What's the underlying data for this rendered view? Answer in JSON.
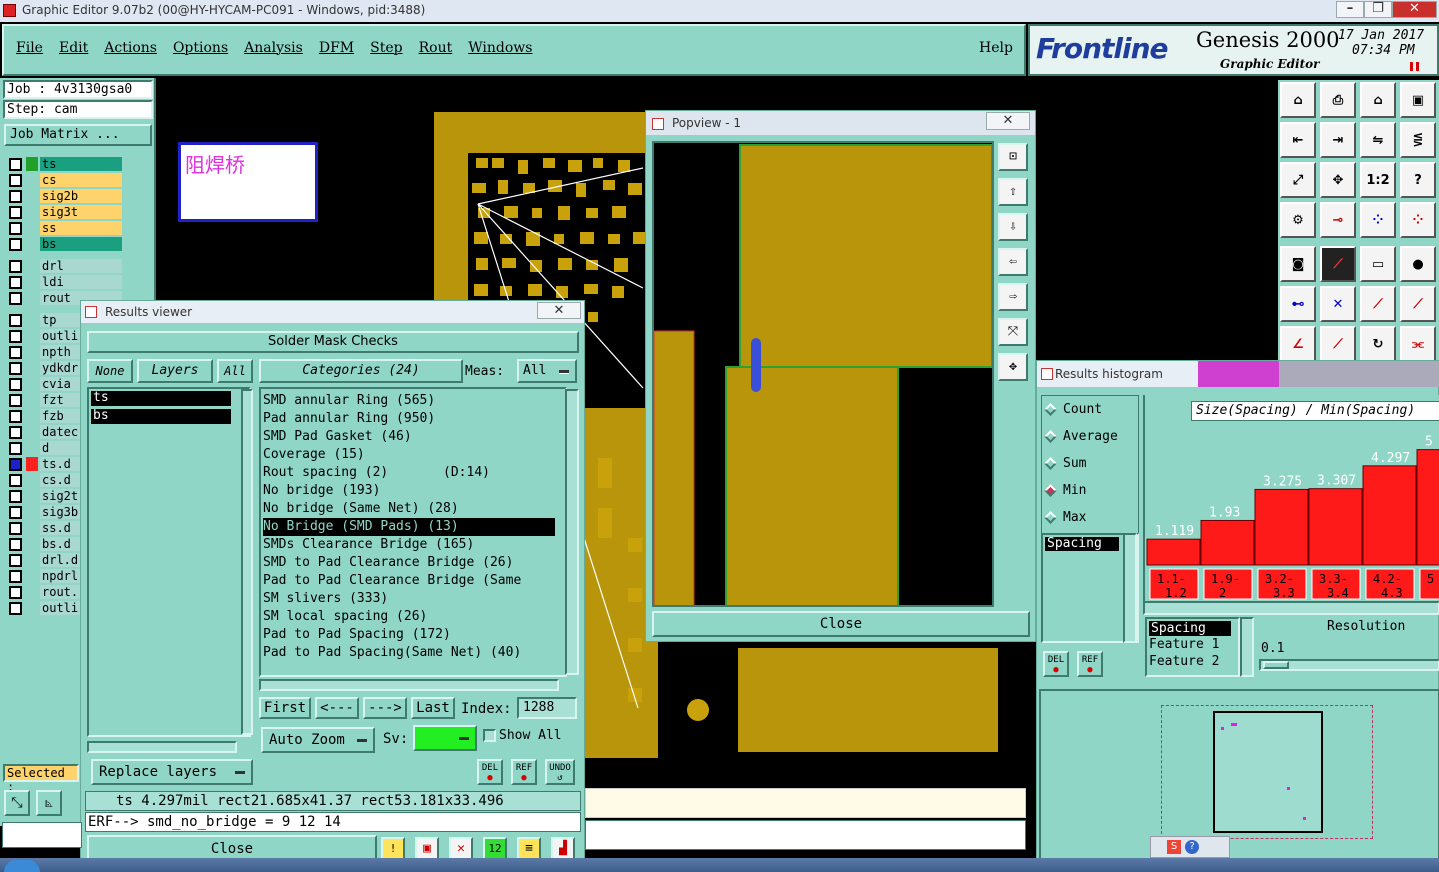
{
  "window": {
    "title": "Graphic Editor 9.07b2 (00@HY-HYCAM-PC091 - Windows, pid:3488)"
  },
  "menu": [
    "File",
    "Edit",
    "Actions",
    "Options",
    "Analysis",
    "DFM",
    "Step",
    "Rout",
    "Windows"
  ],
  "help": "Help",
  "brand": {
    "logo": "Frontline",
    "product": "Genesis 2000",
    "sub": "Graphic Editor",
    "date": "17 Jan 2017",
    "time": "07:34 PM"
  },
  "job": {
    "job": "Job : 4v3130gsa0",
    "step": "Step: cam",
    "matrix": "Job Matrix ..."
  },
  "layers": [
    {
      "name": "ts",
      "color": "#1aa080",
      "sw": "#23a02a"
    },
    {
      "name": "cs",
      "color": "#ffd36b",
      "sw": ""
    },
    {
      "name": "sig2b",
      "color": "#ffd36b",
      "sw": ""
    },
    {
      "name": "sig3t",
      "color": "#ffd36b",
      "sw": ""
    },
    {
      "name": "ss",
      "color": "#ffd36b",
      "sw": ""
    },
    {
      "name": "bs",
      "color": "#1aa080",
      "sw": ""
    },
    {
      "name": "drl",
      "color": "#a8d8d0",
      "sw": ""
    },
    {
      "name": "ldi",
      "color": "#a8d8d0",
      "sw": ""
    },
    {
      "name": "rout",
      "color": "#a8d8d0",
      "sw": ""
    },
    {
      "name": "tp",
      "color": "#a8d8d0",
      "sw": ""
    },
    {
      "name": "outli",
      "color": "#a8d8d0",
      "sw": ""
    },
    {
      "name": "npth",
      "color": "#a8d8d0",
      "sw": ""
    },
    {
      "name": "ydkdr",
      "color": "#a8d8d0",
      "sw": ""
    },
    {
      "name": "cvia",
      "color": "#a8d8d0",
      "sw": ""
    },
    {
      "name": "fzt",
      "color": "#a8d8d0",
      "sw": ""
    },
    {
      "name": "fzb",
      "color": "#a8d8d0",
      "sw": ""
    },
    {
      "name": "datec",
      "color": "#a8d8d0",
      "sw": ""
    },
    {
      "name": "d",
      "color": "#a8d8d0",
      "sw": ""
    },
    {
      "name": "ts.d",
      "color": "#a8d8d0",
      "sw": "#ff2020"
    },
    {
      "name": "cs.d",
      "color": "#a8d8d0",
      "sw": ""
    },
    {
      "name": "sig2t",
      "color": "#a8d8d0",
      "sw": ""
    },
    {
      "name": "sig3b",
      "color": "#a8d8d0",
      "sw": ""
    },
    {
      "name": "ss.d",
      "color": "#a8d8d0",
      "sw": ""
    },
    {
      "name": "bs.d",
      "color": "#a8d8d0",
      "sw": ""
    },
    {
      "name": "drl.d",
      "color": "#a8d8d0",
      "sw": ""
    },
    {
      "name": "npdrl",
      "color": "#a8d8d0",
      "sw": ""
    },
    {
      "name": "rout.",
      "color": "#a8d8d0",
      "sw": ""
    },
    {
      "name": "outli",
      "color": "#a8d8d0",
      "sw": ""
    }
  ],
  "selected": "Selected :",
  "note": "阻焊桥",
  "results": {
    "title": "Results viewer",
    "header": "Solder Mask Checks",
    "none": "None",
    "layers": "Layers",
    "all": "All",
    "categories": "Categories (24)",
    "meas": "Meas:",
    "meas_val": "All",
    "layer_list": [
      "ts",
      "bs"
    ],
    "items": [
      "SMD annular Ring (565)",
      "Pad annular Ring (950)",
      "SMD Pad Gasket (46)",
      "Coverage (15)",
      "Rout spacing (2)       (D:14)",
      "No bridge (193)",
      "No bridge (Same Net) (28)",
      "No Bridge (SMD Pads) (13)",
      "SMDs Clearance Bridge (165)",
      "SMD to Pad Clearance Bridge (26)",
      "Pad to Pad Clearance Bridge (Same",
      "SM slivers (333)",
      "SM local spacing (26)",
      "Pad to Pad Spacing (172)",
      "Pad to Pad Spacing(Same Net) (40)"
    ],
    "selected_index": 7,
    "first": "First",
    "prev": "<---",
    "next": "--->",
    "last": "Last",
    "index_label": "Index:",
    "index_val": "1288",
    "auto_zoom": "Auto Zoom",
    "sv": "Sv:",
    "show_all": "Show All",
    "replace": "Replace layers",
    "del": "DEL",
    "ref": "REF",
    "undo": "UNDO",
    "status": "ts 4.297mil   rect21.685x41.37   rect53.181x33.496",
    "erf": "ERF--> smd_no_bridge = 9 12 14",
    "close": "Close"
  },
  "popview": {
    "title": "Popview - 1",
    "close": "Close"
  },
  "histogram": {
    "title": "Results histogram",
    "options": [
      "Count",
      "Average",
      "Sum",
      "Min",
      "Max"
    ],
    "selected_option": "Min",
    "list_item": "Spacing",
    "chart_title": "Size(Spacing) / Min(Spacing)",
    "del": "DEL",
    "ref": "REF",
    "legend": [
      "Spacing",
      "Feature 1",
      "Feature 2"
    ],
    "resolution_label": "Resolution",
    "resolution": "0.1"
  },
  "chart_data": {
    "type": "bar",
    "title": "Size(Spacing) / Min(Spacing)",
    "categories": [
      "1.1-1.2",
      "1.9-2",
      "3.2-3.3",
      "3.3-3.4",
      "4.2-4.3",
      "5"
    ],
    "values": [
      1.119,
      1.93,
      3.275,
      3.307,
      4.297,
      5
    ],
    "value_labels": [
      "1.119",
      "1.93",
      "3.275",
      "3.307",
      "4.297",
      "5"
    ],
    "category_labels_top": [
      "1.1-",
      "1.9-",
      "3.2-",
      "3.3-",
      "4.2-",
      "5"
    ],
    "category_labels_bottom": [
      "1.2",
      "2",
      "3.3",
      "3.4",
      "4.3",
      ""
    ]
  }
}
